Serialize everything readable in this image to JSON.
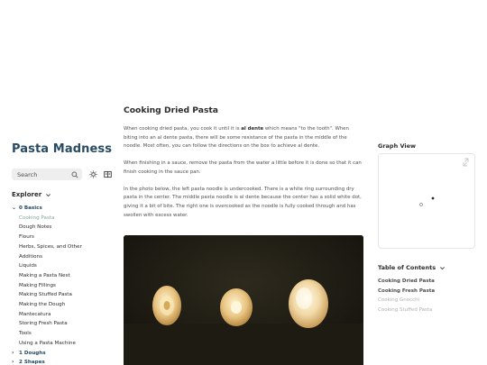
{
  "site": {
    "title": "Pasta Madness"
  },
  "search": {
    "label": "Search"
  },
  "icons": {
    "search": "search-icon",
    "mode": "sun-icon",
    "reader": "book-icon",
    "graph_expand": "expand-icon",
    "chevron": "chevron-down-icon"
  },
  "explorer": {
    "title": "Explorer",
    "folders": [
      {
        "name": "0 Basics",
        "expanded": true,
        "files": [
          "Cooking Pasta",
          "Dough Notes",
          "Flours",
          "Herbs, Spices, and Other",
          "Additions",
          "Liquids",
          "Making a Pasta Nest",
          "Making Fillings",
          "Making Stuffed Pasta",
          "Making the Dough",
          "Mantecatura",
          "Storing Fresh Pasta",
          "Tools",
          "Using a Pasta Machine"
        ]
      },
      {
        "name": "1 Doughs",
        "expanded": false,
        "files": []
      },
      {
        "name": "2 Shapes",
        "expanded": false,
        "files": []
      }
    ],
    "active_file": "Cooking Pasta"
  },
  "article": {
    "title": "Cooking Dried Pasta",
    "p1_before": "When cooking dried pasta, you cook it until it is ",
    "p1_bold": "al dente",
    "p1_after": " which means \"to the tooth\". When biting into an al dente pasta, there will be some resistance of the pasta in the middle of the noodle. Most often, you can follow the directions on the box to achieve al dente.",
    "p2": "When finishing in a sauce, remove the pasta from the water a little before it is done so that it can finish cooking in the sauce pan.",
    "p3": "In the photo below, the left pasta noodle is undercooked. There is a white ring surrounding dry pasta in the center. The middle pasta noodle is al dente because the center has a solid white dot, giving it a bit of bite. The right one is overcooked as the noodle is fully cooked through and has swollen with excess water."
  },
  "graph": {
    "title": "Graph View"
  },
  "toc": {
    "title": "Table of Contents",
    "items": [
      {
        "label": "Cooking Dried Pasta",
        "dim": false
      },
      {
        "label": "Cooking Fresh Pasta",
        "dim": false
      },
      {
        "label": "Cooking Gnocchi",
        "dim": true
      },
      {
        "label": "Cooking Stuffed Pasta",
        "dim": true
      }
    ]
  },
  "colors": {
    "accent": "#284b63",
    "active": "#84a59d",
    "text": "#2b2b2b",
    "muted": "#4e4e4e"
  }
}
